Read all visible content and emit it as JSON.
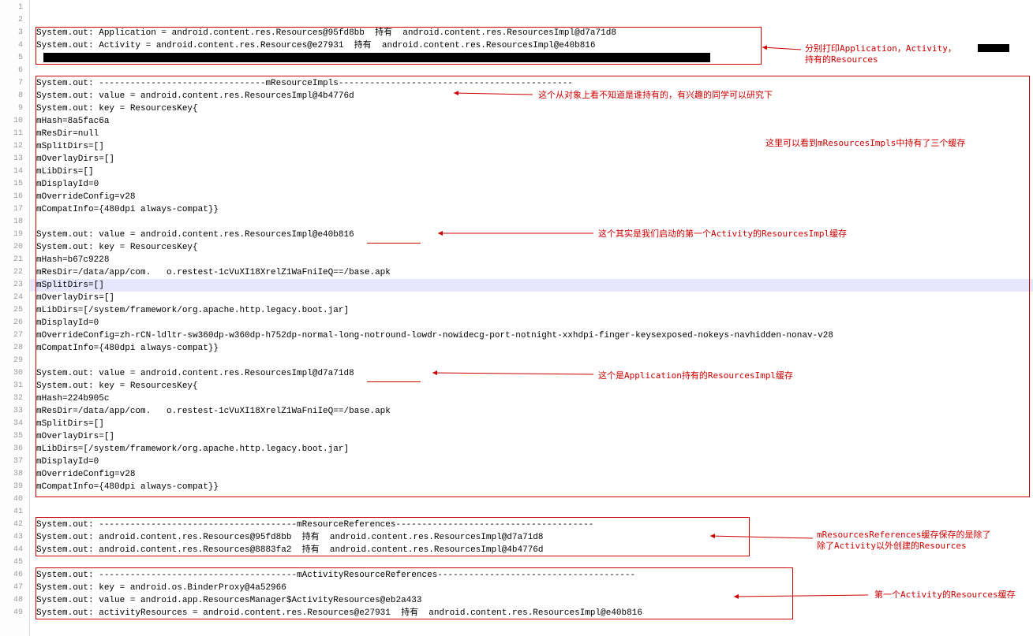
{
  "lines": {
    "l1": "",
    "l2": "",
    "l3": "System.out: Application = android.content.res.Resources@95fd8bb  持有  android.content.res.ResourcesImpl@d7a71d8",
    "l4": "System.out: Activity = android.content.res.Resources@e27931  持有  android.content.res.ResourcesImpl@e40b816",
    "l5_tail": "",
    "l6": "",
    "l7": "System.out: --------------------------------mResourceImpls---------------------------------------------",
    "l8": "System.out: value = android.content.res.ResourcesImpl@4b4776d",
    "l9": "System.out: key = ResourcesKey{",
    "l10": "mHash=8a5fac6a",
    "l11": "mResDir=null",
    "l12": "mSplitDirs=[]",
    "l13": "mOverlayDirs=[]",
    "l14": "mLibDirs=[]",
    "l15": "mDisplayId=0",
    "l16": "mOverrideConfig=v28",
    "l17": "mCompatInfo={480dpi always-compat}}",
    "l18": "",
    "l19": "System.out: value = android.content.res.ResourcesImpl@e40b816",
    "l20": "System.out: key = ResourcesKey{",
    "l21": "mHash=b67c9228",
    "l22": "mResDir=/data/app/com.   o.restest-1cVuXI18XrelZ1WaFniIeQ==/base.apk",
    "l23": "mSplitDirs=[]",
    "l24": "mOverlayDirs=[]",
    "l25": "mLibDirs=[/system/framework/org.apache.http.legacy.boot.jar]",
    "l26": "mDisplayId=0",
    "l27": "mOverrideConfig=zh-rCN-ldltr-sw360dp-w360dp-h752dp-normal-long-notround-lowdr-nowidecg-port-notnight-xxhdpi-finger-keysexposed-nokeys-navhidden-nonav-v28",
    "l28": "mCompatInfo={480dpi always-compat}}",
    "l29": "",
    "l30": "System.out: value = android.content.res.ResourcesImpl@d7a71d8",
    "l31": "System.out: key = ResourcesKey{",
    "l32": "mHash=224b905c",
    "l33": "mResDir=/data/app/com.   o.restest-1cVuXI18XrelZ1WaFniIeQ==/base.apk",
    "l34": "mSplitDirs=[]",
    "l35": "mOverlayDirs=[]",
    "l36": "mLibDirs=[/system/framework/org.apache.http.legacy.boot.jar]",
    "l37": "mDisplayId=0",
    "l38": "mOverrideConfig=v28",
    "l39": "mCompatInfo={480dpi always-compat}}",
    "l40": "",
    "l41": "",
    "l42": "System.out: --------------------------------------mResourceReferences--------------------------------------",
    "l43": "System.out: android.content.res.Resources@95fd8bb  持有  android.content.res.ResourcesImpl@d7a71d8",
    "l44": "System.out: android.content.res.Resources@8883fa2  持有  android.content.res.ResourcesImpl@4b4776d",
    "l45": "",
    "l46": "System.out: --------------------------------------mActivityResourceReferences--------------------------------------",
    "l47": "System.out: key = android.os.BinderProxy@4a52966",
    "l48": "System.out: value = android.app.ResourcesManager$ActivityResources@eb2a433",
    "l49": "System.out: activityResources = android.content.res.Resources@e27931  持有  android.content.res.ResourcesImpl@e40b816"
  },
  "annotations": {
    "a1": "分别打印Application，Activity，\n持有的Resources",
    "a2": "这个从对象上看不知道是谁持有的，有兴趣的同学可以研究下",
    "a3": "这里可以看到mResourcesImpls中持有了三个缓存",
    "a4": "这个其实是我们启动的第一个Activity的ResourcesImpl缓存",
    "a5": "这个是Application持有的ResourcesImpl缓存",
    "a6": "mResourcesReferences缓存保存的是除了\n除了Activity以外创建的Resources",
    "a7": "第一个Activity的Resources缓存"
  },
  "lineCount": 49,
  "highlightLine": 23
}
